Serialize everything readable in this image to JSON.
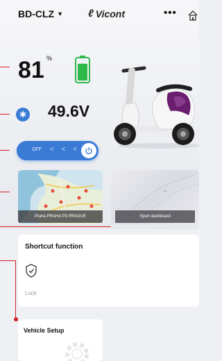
{
  "header": {
    "device_name": "BD-CLZ",
    "logo_text": "Vicont",
    "more": "•••"
  },
  "status": {
    "battery_percent": "81",
    "percent_sign": "%",
    "battery_level": 0.81,
    "voltage": "49.6V"
  },
  "power": {
    "off_label": "OFF",
    "chevrons": "< < <"
  },
  "cards": {
    "map_label": "Praha PRAHA P3 PRAGUE",
    "sport_label": "Sport dashboard"
  },
  "shortcut": {
    "title": "Shortcut function",
    "lock_label": "Lock"
  },
  "vehicle": {
    "title": "Vehicle Setup"
  },
  "colors": {
    "accent": "#3a7bd5",
    "battery": "#2fb84a",
    "annotation": "#d32026"
  }
}
